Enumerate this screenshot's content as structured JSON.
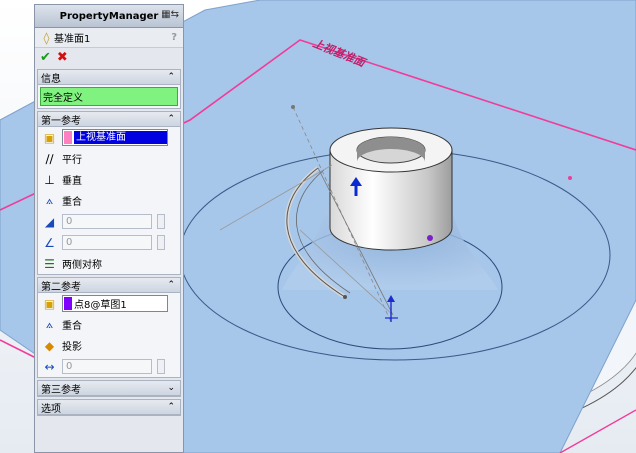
{
  "panel": {
    "title": "PropertyManager",
    "feature_name": "基准面1",
    "help": "?",
    "ok": "✔",
    "cancel": "✖"
  },
  "info": {
    "header": "信息",
    "message": "完全定义"
  },
  "ref1": {
    "header": "第一参考",
    "selection": "上视基准面",
    "color": "#ff80c0",
    "options": [
      "平行",
      "垂直",
      "重合"
    ],
    "offset": "0",
    "angle": "0",
    "symmetric": "两侧对称"
  },
  "ref2": {
    "header": "第二参考",
    "selection": "点8@草图1",
    "color": "#8000ff",
    "options": [
      "重合",
      "投影"
    ],
    "value": "0"
  },
  "ref3": {
    "header": "第三参考"
  },
  "options_section": {
    "header": "选项"
  },
  "viewport": {
    "plane_label": "上视基准面",
    "plane_color": "#f03c9a",
    "surface_color": "#a6c6ea"
  }
}
